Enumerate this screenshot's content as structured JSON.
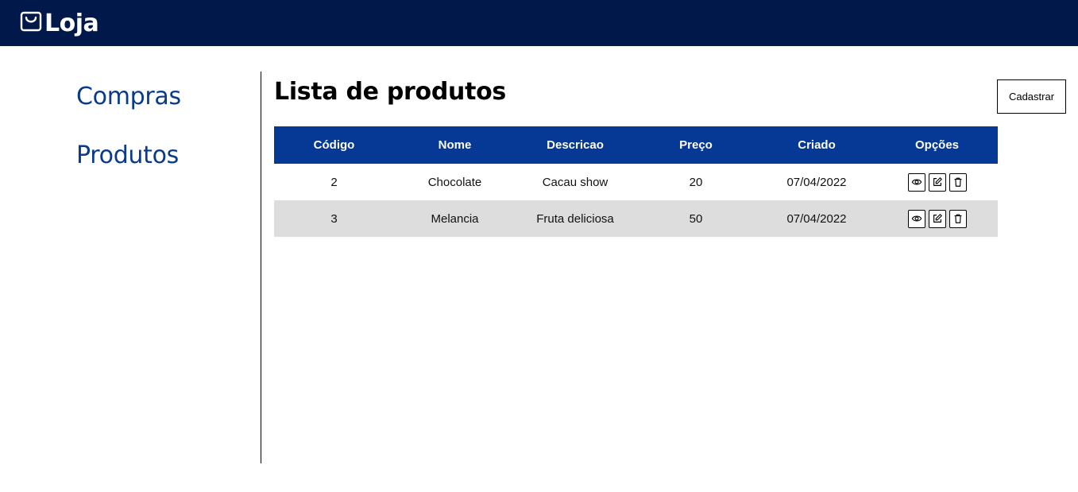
{
  "header": {
    "title": "Loja",
    "icon": "shopping-bag-icon",
    "background": "#00194a"
  },
  "sidebar": {
    "items": [
      {
        "label": "Compras"
      },
      {
        "label": "Produtos"
      }
    ],
    "link_color": "#0a3a8c"
  },
  "main": {
    "title": "Lista de produtos",
    "add_button_label": "Cadastrar",
    "table": {
      "header_color": "#063996",
      "columns": [
        "Código",
        "Nome",
        "Descricao",
        "Preço",
        "Criado",
        "Opções"
      ],
      "rows": [
        {
          "codigo": "2",
          "nome": "Chocolate",
          "descricao": "Cacau show",
          "preco": "20",
          "criado": "07/04/2022"
        },
        {
          "codigo": "3",
          "nome": "Melancia",
          "descricao": "Fruta deliciosa",
          "preco": "50",
          "criado": "07/04/2022"
        }
      ],
      "option_icons": [
        "eye-icon",
        "edit-icon",
        "trash-icon"
      ]
    }
  }
}
